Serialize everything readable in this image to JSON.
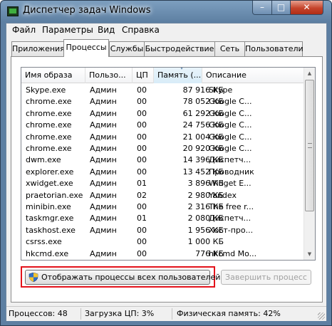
{
  "window": {
    "title": "Диспетчер задач Windows",
    "caption": {
      "minimize": "–",
      "maximize": "□",
      "close": "✕"
    }
  },
  "menu": [
    "Файл",
    "Параметры",
    "Вид",
    "Справка"
  ],
  "tabs": [
    {
      "label": "Приложения",
      "active": false
    },
    {
      "label": "Процессы",
      "active": true
    },
    {
      "label": "Службы",
      "active": false
    },
    {
      "label": "Быстродействие",
      "active": false
    },
    {
      "label": "Сеть",
      "active": false
    },
    {
      "label": "Пользователи",
      "active": false
    }
  ],
  "table": {
    "columns": [
      "Имя образа",
      "Пользо...",
      "ЦП",
      "Память (...",
      "Описание"
    ],
    "sorted_column": "Память (...",
    "rows": [
      [
        "Skype.exe",
        "Админ",
        "00",
        "87 916 КБ",
        "Skype"
      ],
      [
        "chrome.exe",
        "Админ",
        "00",
        "78 052 КБ",
        "Google C..."
      ],
      [
        "chrome.exe",
        "Админ",
        "00",
        "61 292 КБ",
        "Google C..."
      ],
      [
        "chrome.exe",
        "Админ",
        "00",
        "24 756 КБ",
        "Google C..."
      ],
      [
        "chrome.exe",
        "Админ",
        "00",
        "21 004 КБ",
        "Google C..."
      ],
      [
        "chrome.exe",
        "Админ",
        "00",
        "20 920 КБ",
        "Google C..."
      ],
      [
        "dwm.exe",
        "Админ",
        "00",
        "14 396 КБ",
        "Диспетч..."
      ],
      [
        "explorer.exe",
        "Админ",
        "00",
        "13 452 КБ",
        "Проводник"
      ],
      [
        "xwidget.exe",
        "Админ",
        "01",
        "3 896 КБ",
        "Widget E..."
      ],
      [
        "praetorian.exe",
        "Админ",
        "02",
        "2 980 КБ",
        "Yandex"
      ],
      [
        "minibin.exe",
        "Админ",
        "00",
        "2 316 КБ",
        "The free r..."
      ],
      [
        "taskmgr.exe",
        "Админ",
        "01",
        "2 080 КБ",
        "Диспетч..."
      ],
      [
        "taskhost.exe",
        "Админ",
        "00",
        "1 956 КБ",
        "Хост-про..."
      ],
      [
        "csrss.exe",
        "",
        "00",
        "1 000 КБ",
        ""
      ],
      [
        "hkcmd.exe",
        "Админ",
        "00",
        "776 КБ",
        "hkcmd Mo..."
      ]
    ]
  },
  "buttons": {
    "show_all": "Отображать процессы всех пользователей",
    "end_process": "Завершить процесс"
  },
  "status": {
    "processes": "Процессов: 48",
    "cpu": "Загрузка ЦП: 3%",
    "memory": "Физическая память: 42%"
  },
  "colors": {
    "highlight": "#e3131b",
    "titlebar": "#5d7fa2"
  },
  "icons": {
    "app": "task-manager-icon",
    "shield": "uac-shield-icon"
  }
}
